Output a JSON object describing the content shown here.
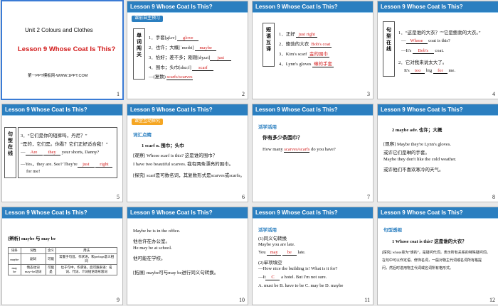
{
  "slides": [
    {
      "num": "1",
      "unit": "Unit 2  Colours and Clothes",
      "lesson": "Lesson 9 Whose Coat Is This?",
      "footer": "第一PPT模板网-WWW.1PPT.COM"
    },
    {
      "num": "2",
      "header": "Lesson 9   Whose Coat Is This?",
      "tag": "课前自主预习",
      "side": "单词闯关",
      "items": [
        {
          "label": "1．手套[glʌv]",
          "answer": "glove"
        },
        {
          "label": "2．也许；大概[ˈmeɪbi]",
          "answer": "maybe"
        },
        {
          "label": "3．恰好；差不多；刚刚[dʒʌst]",
          "answer": "just"
        },
        {
          "label": "4．围巾；头巾[skɑːf]",
          "answer": "scarf"
        },
        {
          "label": "—(复数)",
          "answer": "scarfs/scarves"
        }
      ]
    },
    {
      "num": "3",
      "header": "Lesson 9   Whose Coat Is This?",
      "side": "短语互译",
      "items": [
        {
          "label": "1．正好",
          "answer": "just right"
        },
        {
          "label": "2．鲍勃的大衣",
          "answer": "Bob's coat"
        },
        {
          "label": "3．Kim's scarf",
          "answer": "金的围巾"
        },
        {
          "label": "4．Lynn's gloves",
          "answer": "琳的手套"
        }
      ]
    },
    {
      "num": "4",
      "header": "Lesson 9   Whose Coat Is This?",
      "side": "句型在线",
      "items": [
        {
          "label": "1．“这是谁的大衣？”“它是鲍勃的大衣。”"
        },
        {
          "label": "—",
          "answer": "Whose",
          "rest": "coat is this?"
        },
        {
          "label": "—It's",
          "answer": "Bob's",
          "rest": "coat."
        },
        {
          "label": "2．它对我来说太大了。"
        },
        {
          "label": "It's",
          "answer": "too",
          "mid": "big",
          "answer2": "for",
          "rest": "me."
        }
      ]
    },
    {
      "num": "5",
      "header": "Lesson 9   Whose Coat Is This?",
      "side": "句型在线",
      "items": [
        {
          "label": "3．“它们是你的短裤吗，丹尼？”"
        },
        {
          "label": "“是的，它们是。你看？它们正好适合我！”"
        },
        {
          "label": "—",
          "answer": "Are",
          "mid": "",
          "answer2": "they",
          "rest": "your shorts, Danny?"
        },
        {
          "label": "—Yes，they are. See? They're",
          "answer": "just",
          "answer2": "right"
        },
        {
          "label": "for me!"
        }
      ]
    },
    {
      "num": "6",
      "header": "Lesson 9   Whose Coat Is This?",
      "tag": "课堂互动探究",
      "sub": "词汇点睛",
      "items": [
        {
          "label": "1    scarf n. 围巾；头巾"
        },
        {
          "label": "[观察] Whose scarf is this? 这是谁的围巾？"
        },
        {
          "label": "I have two beautiful scarves. 我有两条漂亮的围巾。"
        },
        {
          "label": "[探究] scarf是可数名词，其复数形式是scarves或scarfs。"
        }
      ]
    },
    {
      "num": "7",
      "header": "Lesson 9   Whose Coat Is This?",
      "sub": "活学活用",
      "items": [
        {
          "label": "你有多少条围巾？"
        },
        {
          "label": "How many",
          "answer": "scarves/scarfs",
          "rest": "do you have?"
        }
      ]
    },
    {
      "num": "8",
      "header": "Lesson 9   Whose Coat Is This?",
      "items": [
        {
          "label": "2    maybe adv. 也许；大概"
        },
        {
          "label": "[观察] Maybe they're Lynn's gloves."
        },
        {
          "label": "或许它们是琳的手套。"
        },
        {
          "label": "Maybe they don't like the cold weather."
        },
        {
          "label": "或许他们不喜欢寒冷的天气。"
        }
      ]
    },
    {
      "num": "9",
      "header": "Lesson 9   Whose Coat Is This?",
      "sub": "[辨析] maybe 与 may be",
      "table": [
        [
          "词条",
          "词性",
          "含义",
          "用法"
        ],
        [
          "maybe",
          "副词",
          "可能",
          "常置于句首，作状语，和perhaps意义相同"
        ],
        [
          "may be",
          "情态动词may+be动词",
          "可能是",
          "位于句中，作谓语，后可跟表语：名词、代词、介词短语等形容词"
        ]
      ]
    },
    {
      "num": "10",
      "header": "Lesson 9   Whose Coat Is This?",
      "items": [
        {
          "label": "Maybe he is in the office."
        },
        {
          "label": "他也许在办公室。"
        },
        {
          "label": "He may be at school."
        },
        {
          "label": "他可能在学校。"
        },
        {
          "label": "[拓展] maybe可与may be进行同义句转换。"
        }
      ]
    },
    {
      "num": "11",
      "header": "Lesson 9   Whose Coat Is This?",
      "sub": "活学活用",
      "items": [
        {
          "label": "(1)同义句转换"
        },
        {
          "label": "Maybe you are late."
        },
        {
          "label": "You",
          "answer": "may",
          "answer2": "be",
          "rest": "late."
        },
        {
          "label": "(2)单项填空"
        },
        {
          "label": "—How nice the building is! What is it for?"
        },
        {
          "label": "—It",
          "answer": "C",
          "rest": "a hotel. But I'm not sure."
        },
        {
          "label": "A. must be   B. have to be   C. may be   D. maybe"
        }
      ]
    },
    {
      "num": "12",
      "header": "Lesson 9   Whose Coat Is This?",
      "sub": "句型透视",
      "items": [
        {
          "label": "1    Whose coat is this? 这是谁的大衣？"
        },
        {
          "label": "[探究] whose意为“谁的”，是疑问代词，表示所有关系的特殊疑问词。"
        },
        {
          "label": "在句中可以作定语、修饰名词，一般对物主代词或名词所有格提"
        },
        {
          "label": "问，然后时进用物主代词或名词所有格形式。"
        }
      ]
    }
  ]
}
